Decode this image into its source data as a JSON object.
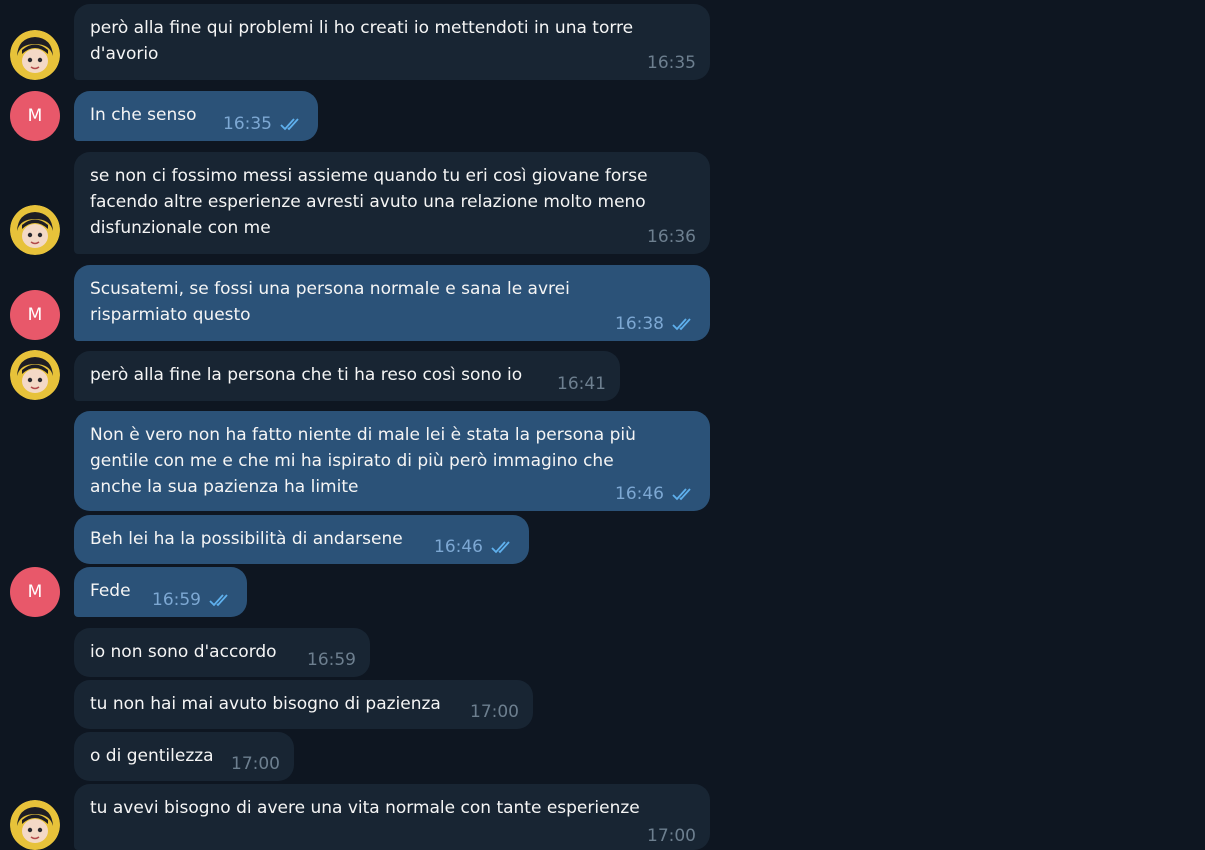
{
  "colors": {
    "background": "#0e1621",
    "incoming_bubble": "#182533",
    "outgoing_bubble": "#2b5278",
    "avatar_m": "#e8586a",
    "read_check": "#5fb0ed"
  },
  "avatars": {
    "m_letter": "M",
    "contact_icon": "anime-avatar-icon"
  },
  "messages": [
    {
      "dir": "in",
      "lines": [
        "però alla fine qui problemi li ho creati io mettendoti in una torre",
        "d'avorio"
      ],
      "time": "16:35"
    },
    {
      "dir": "out",
      "lines": [
        "In che senso"
      ],
      "time": "16:35"
    },
    {
      "dir": "in",
      "lines": [
        "se non ci fossimo messi assieme quando tu eri così giovane forse",
        "facendo altre esperienze avresti avuto una relazione molto meno",
        "disfunzionale con me"
      ],
      "time": "16:36"
    },
    {
      "dir": "out",
      "lines": [
        "Scusatemi, se fossi una persona normale e sana le avrei",
        "risparmiato questo"
      ],
      "time": "16:38"
    },
    {
      "dir": "in",
      "lines": [
        "però alla fine la persona che ti ha reso così sono io"
      ],
      "time": "16:41"
    },
    {
      "dir": "out",
      "lines": [
        "Non è vero non ha fatto niente di male lei è stata la persona più",
        "gentile con me e che mi ha ispirato di più però immagino che",
        "anche la sua pazienza ha limite"
      ],
      "time": "16:46"
    },
    {
      "dir": "out",
      "lines": [
        "Beh lei ha la possibilità di andarsene"
      ],
      "time": "16:46"
    },
    {
      "dir": "out",
      "lines": [
        "Fede"
      ],
      "time": "16:59"
    },
    {
      "dir": "in",
      "lines": [
        "io non sono d'accordo"
      ],
      "time": "16:59"
    },
    {
      "dir": "in",
      "lines": [
        "tu non hai mai avuto bisogno di pazienza"
      ],
      "time": "17:00"
    },
    {
      "dir": "in",
      "lines": [
        "o di gentilezza"
      ],
      "time": "17:00"
    },
    {
      "dir": "in",
      "lines": [
        "tu avevi bisogno di avere una vita normale con tante esperienze"
      ],
      "time": "17:00"
    }
  ]
}
